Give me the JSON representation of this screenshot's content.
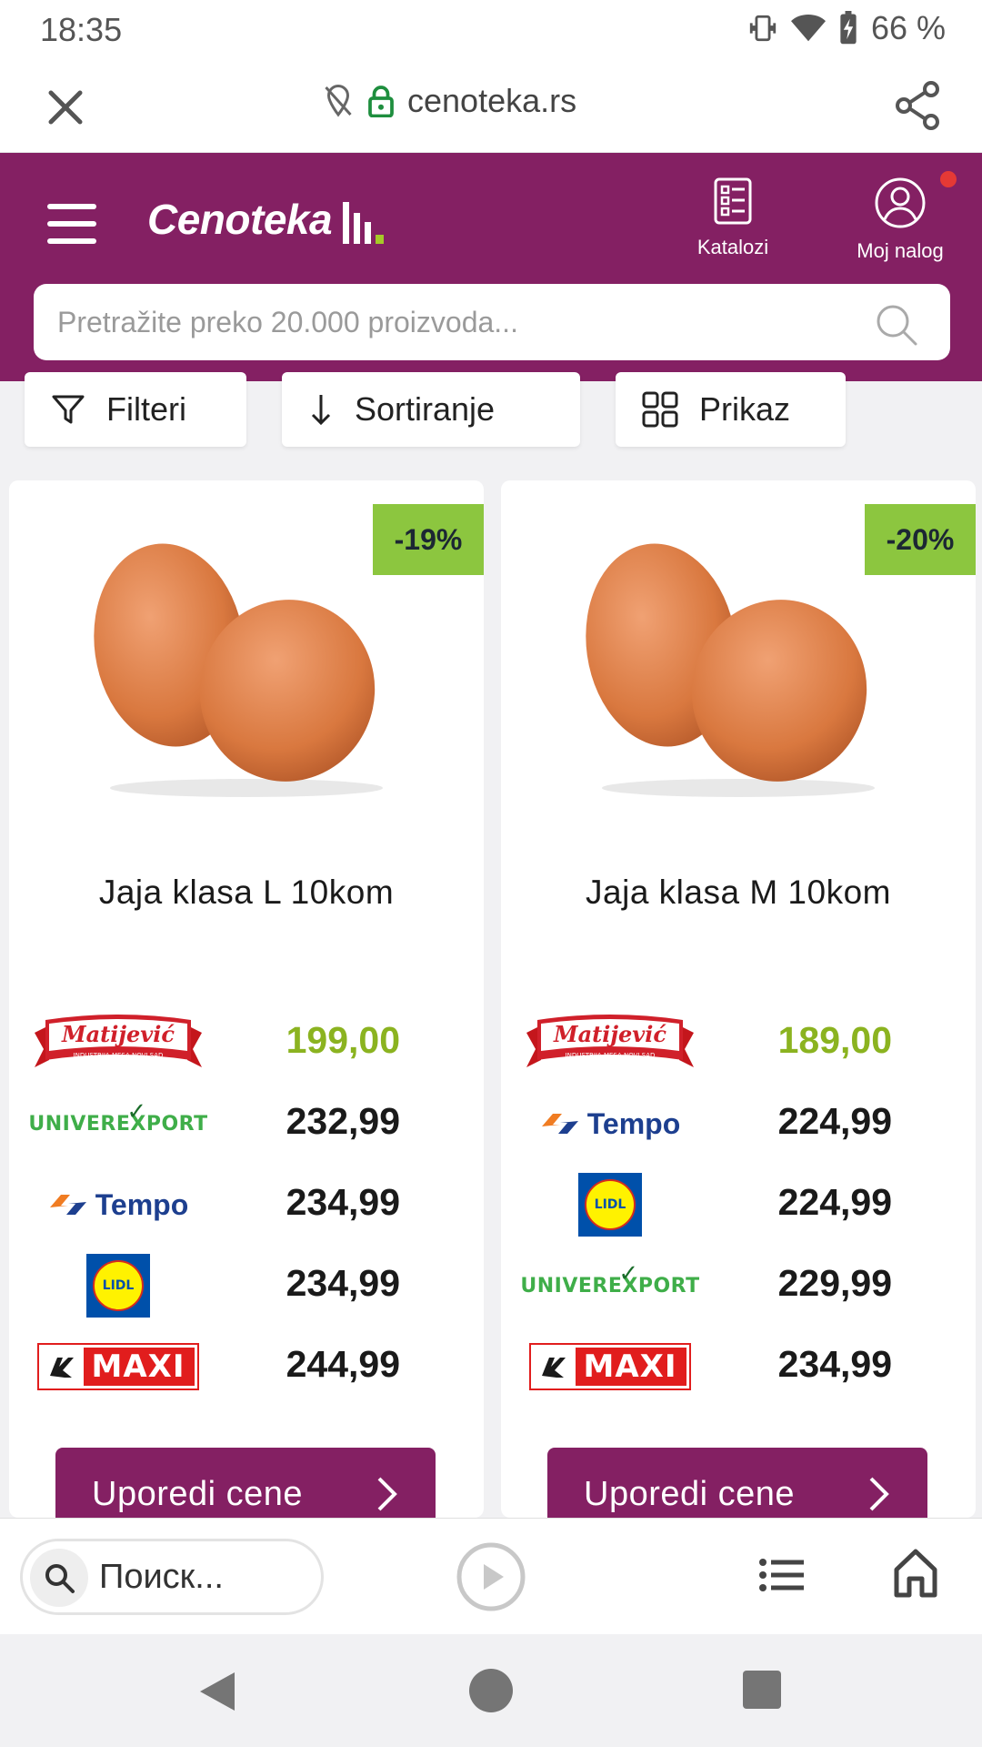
{
  "status_bar": {
    "time": "18:35",
    "battery_percent": "66 %",
    "icons": [
      "vibrate-icon",
      "wifi-icon",
      "battery-charging-icon"
    ]
  },
  "browser": {
    "url": "cenoteka.rs",
    "icons": [
      "close-icon",
      "tracking-off-icon",
      "lock-icon",
      "share-icon"
    ]
  },
  "site_header": {
    "logo_text": "Cenoteka",
    "katalozi_label": "Katalozi",
    "nalog_label": "Moj nalog",
    "search_placeholder": "Pretražite preko 20.000 proizvoda...",
    "colors": {
      "brand": "#842063",
      "accent_green": "#8cc63f",
      "notification": "#e53935"
    }
  },
  "toolbar": {
    "filteri": "Filteri",
    "sortiranje": "Sortiranje",
    "prikaz": "Prikaz"
  },
  "products": [
    {
      "name": "Jaja klasa L 10kom",
      "discount": "-19%",
      "image": "brown-eggs-image",
      "offers": [
        {
          "store": "Matijević",
          "logo": "matijevic-logo",
          "price": "199,00",
          "best": true
        },
        {
          "store": "Univerexport",
          "logo": "univerexport-logo",
          "price": "232,99",
          "best": false
        },
        {
          "store": "Tempo",
          "logo": "tempo-logo",
          "price": "234,99",
          "best": false
        },
        {
          "store": "Lidl",
          "logo": "lidl-logo",
          "price": "234,99",
          "best": false
        },
        {
          "store": "Maxi",
          "logo": "maxi-logo",
          "price": "244,99",
          "best": false
        }
      ],
      "compare_label": "Uporedi cene"
    },
    {
      "name": "Jaja klasa M 10kom",
      "discount": "-20%",
      "image": "brown-eggs-image",
      "offers": [
        {
          "store": "Matijević",
          "logo": "matijevic-logo",
          "price": "189,00",
          "best": true
        },
        {
          "store": "Tempo",
          "logo": "tempo-logo",
          "price": "224,99",
          "best": false
        },
        {
          "store": "Lidl",
          "logo": "lidl-logo",
          "price": "224,99",
          "best": false
        },
        {
          "store": "Univerexport",
          "logo": "univerexport-logo",
          "price": "229,99",
          "best": false
        },
        {
          "store": "Maxi",
          "logo": "maxi-logo",
          "price": "234,99",
          "best": false
        }
      ],
      "compare_label": "Uporedi cene"
    }
  ],
  "logo_texts": {
    "matijevic": "Matijević",
    "matijevic_sub": "INDUSTRIJA MESA NOVI SAD",
    "univerexport": "UNIVEREXPORT",
    "tempo": "Tempo",
    "lidl": "LIDL",
    "maxi": "MAXI"
  },
  "bottom_bar": {
    "search_placeholder": "Поиск..."
  }
}
